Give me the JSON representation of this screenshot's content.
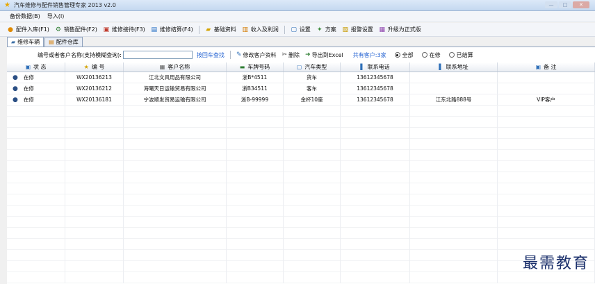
{
  "window": {
    "title": "汽车维修与配件销售管理专家 2013 v2.0",
    "controls": [
      "—",
      "□",
      "✕"
    ]
  },
  "menu": [
    "备份数据(B)",
    "导入(I)"
  ],
  "toolbar": [
    {
      "label": "配件入库(F1)",
      "icon": "inbound-icon",
      "glyph": "●",
      "color": "#e08a00"
    },
    {
      "label": "销售配件(F2)",
      "icon": "gear-icon",
      "glyph": "⚙",
      "color": "#2e7d32"
    },
    {
      "label": "维修接待(F3)",
      "icon": "reception-icon",
      "glyph": "▣",
      "color": "#c0392b"
    },
    {
      "label": "维修结算(F4)",
      "icon": "settlement-icon",
      "glyph": "▤",
      "color": "#1565c0"
    },
    {
      "label": "基础资料",
      "icon": "folder-icon",
      "glyph": "▰",
      "color": "#d4a300"
    },
    {
      "label": "收入及利润",
      "icon": "chart-icon",
      "glyph": "▥",
      "color": "#d47a00"
    },
    {
      "label": "设置",
      "icon": "settings-icon",
      "glyph": "▢",
      "color": "#2e6fb8"
    },
    {
      "label": "方案",
      "icon": "plan-icon",
      "glyph": "✦",
      "color": "#3b8a3b"
    },
    {
      "label": "报警设置",
      "icon": "alarm-icon",
      "glyph": "▧",
      "color": "#c79a00"
    },
    {
      "label": "升级为正式版",
      "icon": "upgrade-icon",
      "glyph": "▦",
      "color": "#8e44ad"
    }
  ],
  "tabs": [
    {
      "label": "维修车辆",
      "active": true
    },
    {
      "label": "配件仓库",
      "active": false
    }
  ],
  "filter": {
    "search_label": "编号或者客户名称(支持模糊查询):",
    "search_value": "",
    "find_link": "按回车查找",
    "edit_button": "修改客户资料",
    "delete_button": "删除",
    "export_button": "导出到Excel",
    "count_text": "共有客户:3家",
    "radios": [
      {
        "label": "全部",
        "checked": true
      },
      {
        "label": "在修",
        "checked": false
      },
      {
        "label": "已结算",
        "checked": false
      }
    ]
  },
  "grid": {
    "columns": [
      "状 态",
      "编 号",
      "客户名称",
      "车牌号码",
      "汽车类型",
      "联系电话",
      "联系地址",
      "备 注"
    ],
    "rows": [
      [
        "在修",
        "WX20136213",
        "江北文具用品有限公司",
        "浙B*4511",
        "货车",
        "13612345678",
        "",
        ""
      ],
      [
        "在修",
        "WX20136212",
        "海曙天日运输贸易有限公司",
        "浙B34511",
        "客车",
        "13612345678",
        "",
        ""
      ],
      [
        "在修",
        "WX20136181",
        "宁波顺发贸易运输有限公司",
        "浙B-99999",
        "金杯10座",
        "13612345678",
        "江东北路888号",
        "VIP客户"
      ]
    ]
  },
  "watermark": "最需教育"
}
